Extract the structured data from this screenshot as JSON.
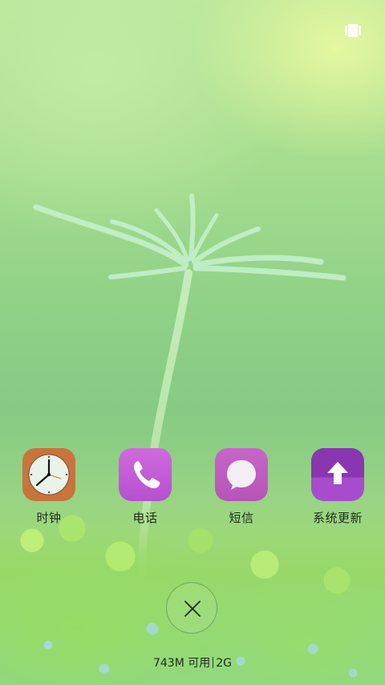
{
  "status_bar": {
    "icon": "multi-window-icon"
  },
  "apps": [
    {
      "label": "时钟",
      "icon": "clock-icon",
      "color": "#c8743c"
    },
    {
      "label": "电话",
      "icon": "phone-icon",
      "color": "#c15fd6"
    },
    {
      "label": "短信",
      "icon": "message-icon",
      "color": "#c25fbf"
    },
    {
      "label": "系统更新",
      "icon": "upload-arrow-icon",
      "color": "#7d2fa6"
    }
  ],
  "recents": {
    "close_icon": "close-icon",
    "memory_available": "743M 可用",
    "memory_total": "2G"
  }
}
